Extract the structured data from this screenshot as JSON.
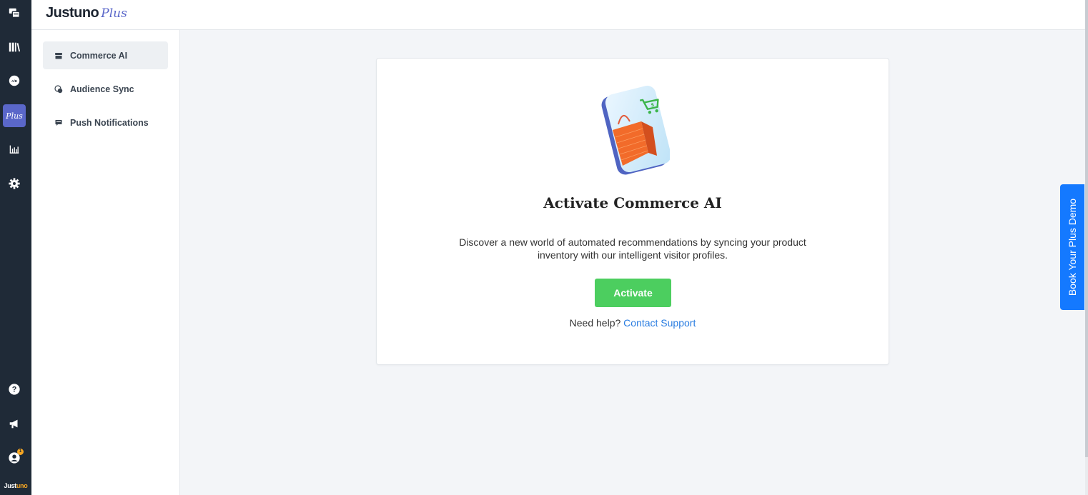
{
  "app": {
    "logo_main": "Justuno",
    "logo_plus": "Plus",
    "rail_brand_main": "Just",
    "rail_brand_accent": "uno",
    "rail_active_label": "Plus",
    "notification_count": "1"
  },
  "subnav": {
    "items": [
      {
        "label": "Commerce AI",
        "icon": "store-icon",
        "active": true
      },
      {
        "label": "Audience Sync",
        "icon": "sync-icon",
        "active": false
      },
      {
        "label": "Push Notifications",
        "icon": "chat-icon",
        "active": false
      }
    ]
  },
  "card": {
    "title": "Activate Commerce AI",
    "description": "Discover a new world of automated recommendations by syncing your product inventory with our intelligent visitor profiles.",
    "activate_label": "Activate",
    "help_text": "Need help?",
    "help_link": "Contact Support"
  },
  "demo_tab": {
    "label": "Book Your Plus Demo"
  },
  "colors": {
    "rail": "#1f2a37",
    "accent": "#5a67c9",
    "activate": "#4cce5f",
    "link": "#2a7de1",
    "demo_tab": "#1479ff"
  }
}
